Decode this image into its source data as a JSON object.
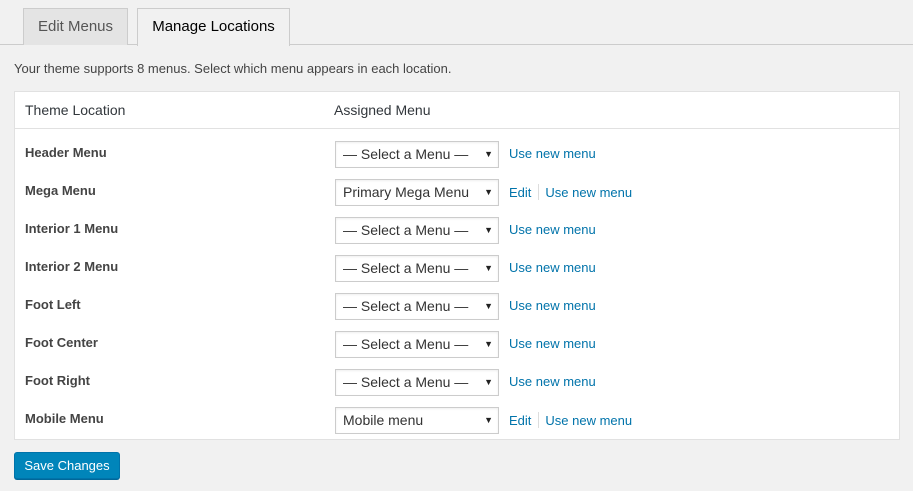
{
  "tabs": [
    {
      "label": "Edit Menus",
      "active": false
    },
    {
      "label": "Manage Locations",
      "active": true
    }
  ],
  "description": "Your theme supports 8 menus. Select which menu appears in each location.",
  "table": {
    "headers": {
      "location": "Theme Location",
      "menu": "Assigned Menu"
    },
    "rows": [
      {
        "location": "Header Menu",
        "selected": "— Select a Menu —",
        "edit": null,
        "use_new": "Use new menu"
      },
      {
        "location": "Mega Menu",
        "selected": "Primary Mega Menu",
        "edit": "Edit",
        "use_new": "Use new menu"
      },
      {
        "location": "Interior 1 Menu",
        "selected": "— Select a Menu —",
        "edit": null,
        "use_new": "Use new menu"
      },
      {
        "location": "Interior 2 Menu",
        "selected": "— Select a Menu —",
        "edit": null,
        "use_new": "Use new menu"
      },
      {
        "location": "Foot Left",
        "selected": "— Select a Menu —",
        "edit": null,
        "use_new": "Use new menu"
      },
      {
        "location": "Foot Center",
        "selected": "— Select a Menu —",
        "edit": null,
        "use_new": "Use new menu"
      },
      {
        "location": "Foot Right",
        "selected": "— Select a Menu —",
        "edit": null,
        "use_new": "Use new menu"
      },
      {
        "location": "Mobile Menu",
        "selected": "Mobile menu",
        "edit": "Edit",
        "use_new": "Use new menu"
      }
    ]
  },
  "save_label": "Save Changes",
  "icons": {
    "dropdown": "dropdown-caret-icon"
  },
  "colors": {
    "link": "#0073aa",
    "primary_button": "#0085ba"
  }
}
